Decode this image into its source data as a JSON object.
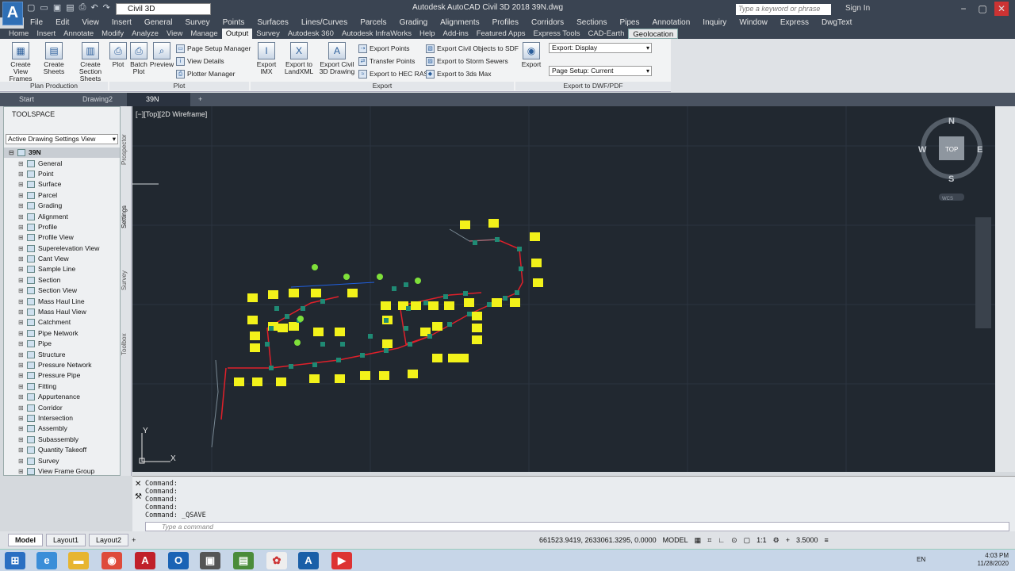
{
  "title_bar": {
    "app_logo": "A",
    "workspace": "Civil 3D",
    "title": "Autodesk AutoCAD Civil 3D 2018    39N.dwg",
    "search_placeholder": "Type a keyword or phrase",
    "sign_in": "Sign In"
  },
  "menu": [
    "File",
    "Edit",
    "View",
    "Insert",
    "General",
    "Survey",
    "Points",
    "Surfaces",
    "Lines/Curves",
    "Parcels",
    "Grading",
    "Alignments",
    "Profiles",
    "Corridors",
    "Sections",
    "Pipes",
    "Annotation",
    "Inquiry",
    "Window",
    "Express",
    "DwgText"
  ],
  "ribbon_tabs": [
    "Home",
    "Insert",
    "Annotate",
    "Modify",
    "Analyze",
    "View",
    "Manage",
    "Output",
    "Survey",
    "Autodesk 360",
    "Autodesk InfraWorks",
    "Help",
    "Add-ins",
    "Featured Apps",
    "Express Tools",
    "CAD-Earth",
    "Geolocation"
  ],
  "ribbon": {
    "plan_production": {
      "label": "Plan Production",
      "buttons": [
        "Create View Frames",
        "Create Sheets",
        "Create Section Sheets"
      ]
    },
    "plot": {
      "label": "Plot",
      "buttons": [
        "Plot",
        "Batch Plot",
        "Preview"
      ],
      "small": [
        "Page Setup Manager",
        "View Details",
        "Plotter Manager"
      ]
    },
    "export": {
      "label": "Export",
      "buttons": [
        "Export IMX",
        "Export to LandXML",
        "Export Civil 3D Drawing"
      ],
      "small_col1": [
        "Export Points",
        "Transfer Points",
        "Export to HEC RAS"
      ],
      "small_col2": [
        "Export Civil Objects to SDF",
        "Export to Storm Sewers",
        "Export to 3ds Max"
      ]
    },
    "dwf": {
      "label": "Export to DWF/PDF",
      "button": "Export",
      "export_combo": "Export: Display",
      "page_setup_combo": "Page Setup: Current"
    }
  },
  "doc_tabs": [
    "Start",
    "Drawing2",
    "39N"
  ],
  "toolspace": {
    "title": "TOOLSPACE",
    "view": "Active Drawing Settings View",
    "root": "39N",
    "items": [
      "General",
      "Point",
      "Surface",
      "Parcel",
      "Grading",
      "Alignment",
      "Profile",
      "Profile View",
      "Superelevation View",
      "Cant View",
      "Sample Line",
      "Section",
      "Section View",
      "Mass Haul Line",
      "Mass Haul View",
      "Catchment",
      "Pipe Network",
      "Pipe",
      "Structure",
      "Pressure Network",
      "Pressure Pipe",
      "Fitting",
      "Appurtenance",
      "Corridor",
      "Intersection",
      "Assembly",
      "Subassembly",
      "Quantity Takeoff",
      "Survey",
      "View Frame Group"
    ],
    "side_tabs": [
      "Prospector",
      "Settings",
      "Survey",
      "Toolbox"
    ]
  },
  "viewport": {
    "label": "[−][Top][2D Wireframe]",
    "viewcube": {
      "top": "TOP",
      "n": "N",
      "s": "S",
      "e": "E",
      "w": "W",
      "wcs": "WCS"
    },
    "ucs": {
      "x": "X",
      "y": "Y"
    }
  },
  "command": {
    "history": [
      "Command:",
      "Command:",
      "Command:",
      "Command:",
      "Command: _QSAVE"
    ],
    "placeholder": "Type a command"
  },
  "layout_tabs": [
    "Model",
    "Layout1",
    "Layout2"
  ],
  "status": {
    "coords": "661523.9419, 2633061.3295, 0.0000",
    "mode": "MODEL",
    "scale": "1:1",
    "elevation": "3.5000"
  },
  "taskbar": {
    "language": "EN",
    "time": "4:03 PM",
    "date": "11/28/2020"
  },
  "colors": {
    "pipe": "#e0202a",
    "structure": "#1f8a74",
    "label": "#f2f21a",
    "viewport": "#212830"
  }
}
